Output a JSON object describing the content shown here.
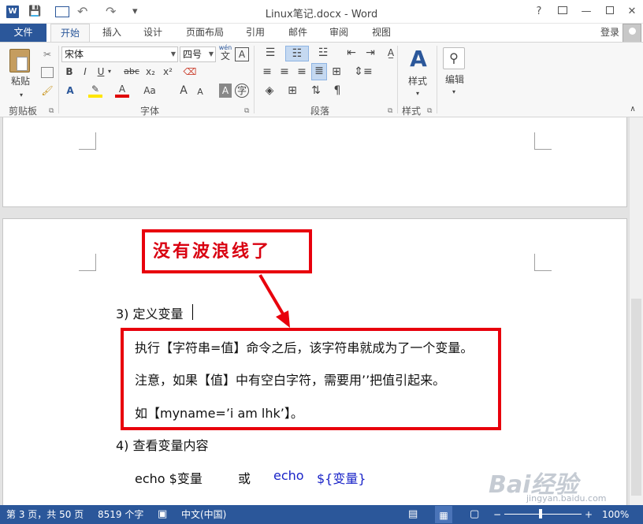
{
  "window": {
    "title": "Linux笔记.docx - Word",
    "help": "?",
    "minimize": "—",
    "close": "✕"
  },
  "qat": {
    "save_icon": "💾",
    "undo_icon": "↶",
    "redo_icon": "↷",
    "customize_icon": "▾"
  },
  "tabs": [
    "文件",
    "开始",
    "插入",
    "设计",
    "页面布局",
    "引用",
    "邮件",
    "审阅",
    "视图"
  ],
  "account": {
    "login": "登录"
  },
  "ribbon": {
    "clipboard": {
      "paste": "粘贴",
      "group": "剪贴板"
    },
    "font": {
      "name": "宋体",
      "size": "四号",
      "wen": "wén",
      "wen_char": "文",
      "bold": "B",
      "italic": "I",
      "underline": "U",
      "strike": "abc",
      "subscript": "x₂",
      "superscript": "x²",
      "color_a": "A",
      "aa": "Aa",
      "grow": "A",
      "shrink": "A",
      "group": "字体"
    },
    "paragraph": {
      "group": "段落"
    },
    "styles": {
      "label": "样式",
      "group": "样式"
    },
    "editing": {
      "label": "编辑"
    }
  },
  "document": {
    "heading3": "3)  定义变量",
    "line1": "执行【字符串=值】命令之后，该字符串就成为了一个变量。",
    "line2": "注意，如果【值】中有空白字符，需要用’’把值引起来。",
    "line3": "如【myname=’i    am    lhk’】。",
    "heading4": "4)  查看变量内容",
    "cmd_a": "echo    $变量",
    "cmd_or": "或",
    "cmd_b": "echo",
    "cmd_c": "${变量}"
  },
  "callout": {
    "text": "没有波浪线了"
  },
  "status": {
    "page": "第 3 页，共 50 页",
    "words": "8519 个字",
    "language": "中文(中国)",
    "zoom": "100%"
  },
  "watermark": {
    "brand": "Bai经验",
    "url": "jingyan.baidu.com"
  },
  "colors": {
    "accent": "#2b579a",
    "callout_red": "#e8000c",
    "link_blue": "#1a24c8"
  }
}
